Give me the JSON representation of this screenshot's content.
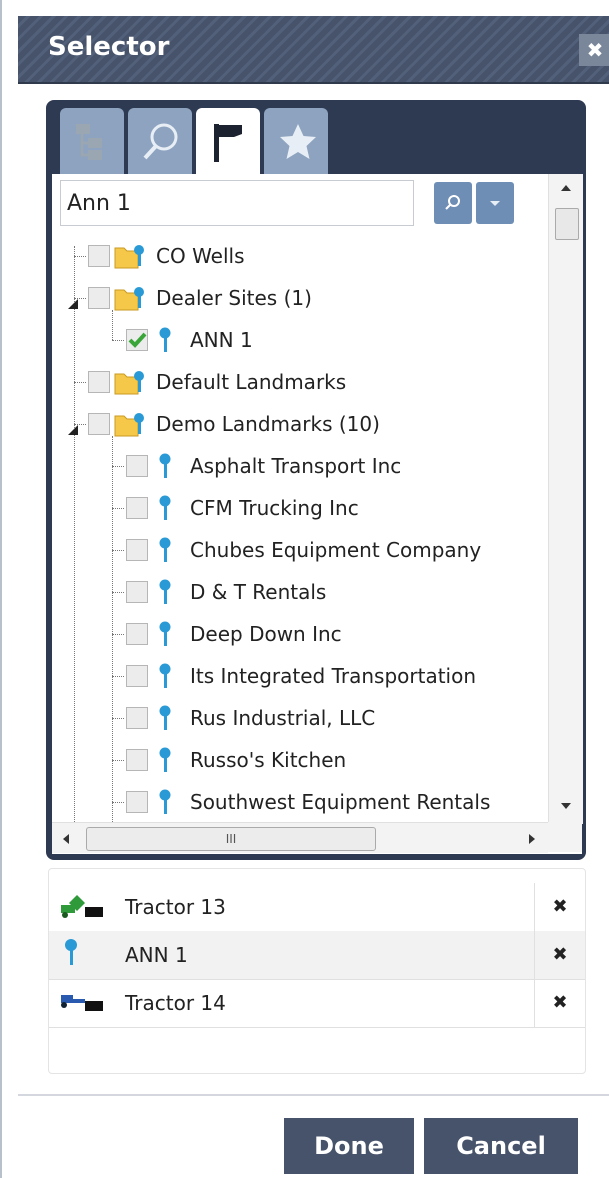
{
  "dialog": {
    "title": "Selector",
    "close_label": "✖"
  },
  "tabs": [
    {
      "name": "tree",
      "icon": "tree-icon",
      "active": false
    },
    {
      "name": "search",
      "icon": "magnifier-icon",
      "active": false
    },
    {
      "name": "flag",
      "icon": "flag-icon",
      "active": true
    },
    {
      "name": "favorites",
      "icon": "star-icon",
      "active": false
    }
  ],
  "search": {
    "value": "Ann 1"
  },
  "tree": {
    "items": [
      {
        "label": "CO Wells",
        "type": "folder",
        "level": 0,
        "checked": false
      },
      {
        "label": "Dealer Sites (1)",
        "type": "folder",
        "level": 0,
        "checked": false,
        "expanded": true
      },
      {
        "label": "ANN 1",
        "type": "landmark",
        "level": 1,
        "checked": true
      },
      {
        "label": "Default Landmarks",
        "type": "folder",
        "level": 0,
        "checked": false
      },
      {
        "label": "Demo Landmarks (10)",
        "type": "folder",
        "level": 0,
        "checked": false,
        "expanded": true
      },
      {
        "label": "Asphalt Transport Inc",
        "type": "landmark",
        "level": 1,
        "checked": false
      },
      {
        "label": "CFM Trucking Inc",
        "type": "landmark",
        "level": 1,
        "checked": false
      },
      {
        "label": "Chubes Equipment Company",
        "type": "landmark",
        "level": 1,
        "checked": false
      },
      {
        "label": "D & T Rentals",
        "type": "landmark",
        "level": 1,
        "checked": false
      },
      {
        "label": "Deep Down Inc",
        "type": "landmark",
        "level": 1,
        "checked": false
      },
      {
        "label": "Its Integrated Transportation",
        "type": "landmark",
        "level": 1,
        "checked": false
      },
      {
        "label": "Rus Industrial, LLC",
        "type": "landmark",
        "level": 1,
        "checked": false
      },
      {
        "label": "Russo's Kitchen",
        "type": "landmark",
        "level": 1,
        "checked": false
      },
      {
        "label": "Southwest Equipment Rentals",
        "type": "landmark",
        "level": 1,
        "checked": false
      }
    ],
    "hscroll_grip": "III"
  },
  "selected": [
    {
      "label": "Tractor 13",
      "icon": "tractor-green-icon",
      "remove": "✖"
    },
    {
      "label": "ANN 1",
      "icon": "landmark-pin-icon",
      "remove": "✖"
    },
    {
      "label": "Tractor 14",
      "icon": "tractor-blue-icon",
      "remove": "✖"
    }
  ],
  "buttons": {
    "done": "Done",
    "cancel": "Cancel"
  },
  "colors": {
    "titlebar": "#46536a",
    "panel": "#2e3a52",
    "tab_inactive": "#8da3bf",
    "button": "#46536a",
    "checked": "#3aa63a"
  }
}
